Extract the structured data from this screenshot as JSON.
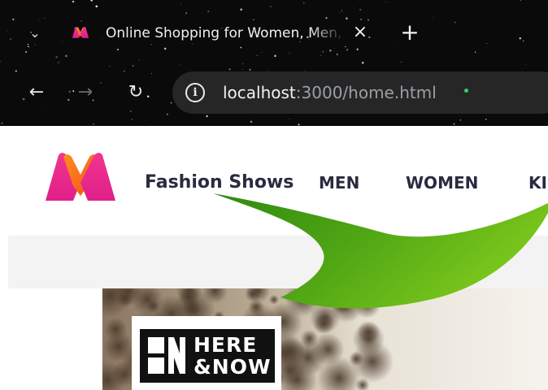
{
  "browser": {
    "tab": {
      "title": "Online Shopping for Women, Men, Kids",
      "close_icon": "×",
      "favicon_icon": "myntra-logo-icon"
    },
    "tab_list_icon": "⌄",
    "new_tab_icon": "+",
    "nav": {
      "back_icon": "←",
      "forward_icon": "→",
      "reload_icon": "↻"
    },
    "address_bar": {
      "site_info_icon": "i",
      "host": "localhost",
      "rest": ":3000/home.html"
    }
  },
  "site": {
    "logo_icon": "myntra-logo-icon",
    "nav": [
      {
        "label": "Fashion Shows"
      },
      {
        "label": "MEN"
      },
      {
        "label": "WOMEN"
      },
      {
        "label": "KIDS"
      }
    ]
  },
  "hero": {
    "brand": {
      "line1": "HERE",
      "line2": "&NOW"
    }
  },
  "colors": {
    "chrome_bg": "#0a0a0a",
    "omnibox_bg": "#262626",
    "nav_text": "#282c3f",
    "arrow_green": "#5fb818",
    "logo_pink": "#e8368f",
    "logo_orange": "#f26a10"
  }
}
